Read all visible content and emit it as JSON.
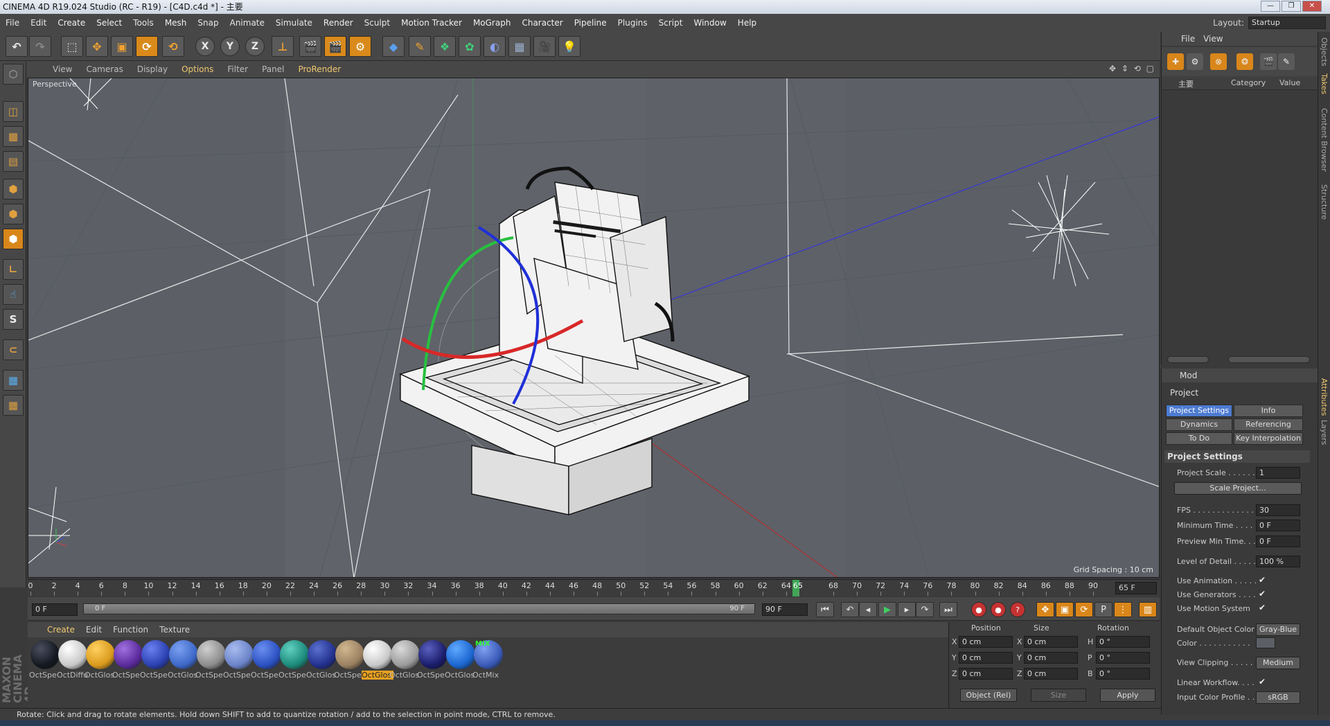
{
  "window": {
    "title": "CINEMA 4D R19.024 Studio (RC - R19) - [C4D.c4d *] - 主要"
  },
  "menu": [
    "File",
    "Edit",
    "Create",
    "Select",
    "Tools",
    "Mesh",
    "Snap",
    "Animate",
    "Simulate",
    "Render",
    "Sculpt",
    "Motion Tracker",
    "MoGraph",
    "Character",
    "Pipeline",
    "Plugins",
    "Script",
    "Window",
    "Help"
  ],
  "layout": {
    "label": "Layout:",
    "value": "Startup"
  },
  "toolbar": {
    "axis_x": "X",
    "axis_y": "Y",
    "axis_z": "Z"
  },
  "viewport_menu": [
    "View",
    "Cameras",
    "Display",
    "Options",
    "Filter",
    "Panel",
    "ProRender"
  ],
  "viewport": {
    "label": "Perspective",
    "grid_spacing": "Grid Spacing : 10 cm",
    "nav": "✥ ⇕ ⟲ ▢"
  },
  "timeline": {
    "ticks": [
      "0",
      "2",
      "4",
      "6",
      "8",
      "10",
      "12",
      "14",
      "16",
      "18",
      "20",
      "22",
      "24",
      "26",
      "28",
      "30",
      "32",
      "34",
      "36",
      "38",
      "40",
      "42",
      "44",
      "46",
      "48",
      "50",
      "52",
      "54",
      "56",
      "58",
      "60",
      "62",
      "64",
      "65",
      "68",
      "70",
      "72",
      "74",
      "76",
      "78",
      "80",
      "82",
      "84",
      "86",
      "88",
      "90"
    ],
    "current_frame": 65,
    "max_frame": 90,
    "end_field": "65 F"
  },
  "transport": {
    "start": "0 F",
    "range_start": "0 F",
    "range_end": "90 F",
    "end": "90 F"
  },
  "material_menu": [
    "Create",
    "Edit",
    "Function",
    "Texture"
  ],
  "materials": [
    {
      "label": "OctSpe",
      "color": "#141820",
      "hi": "#4a5060"
    },
    {
      "label": "OctDiffu",
      "color": "#c8c8c8",
      "hi": "#ffffff"
    },
    {
      "label": "OctGlos",
      "color": "#d99a1c",
      "hi": "#ffd060"
    },
    {
      "label": "OctSpe",
      "color": "#5a2a9c",
      "hi": "#a070e0"
    },
    {
      "label": "OctSpe",
      "color": "#2a40b0",
      "hi": "#6a80f0"
    },
    {
      "label": "OctGlos",
      "color": "#3d68c8",
      "hi": "#7aa0f0"
    },
    {
      "label": "OctSpe",
      "color": "#8c8c8c",
      "hi": "#cfcfcf"
    },
    {
      "label": "OctSpe",
      "color": "#6a82c8",
      "hi": "#a8bcf0"
    },
    {
      "label": "OctSpe",
      "color": "#2a50c0",
      "hi": "#6a8ef0"
    },
    {
      "label": "OctSpe",
      "color": "#1c8a7a",
      "hi": "#60d0c0"
    },
    {
      "label": "OctGlos",
      "color": "#22308c",
      "hi": "#5a70d0"
    },
    {
      "label": "OctSpe",
      "color": "#9a8060",
      "hi": "#d0b890"
    },
    {
      "label": "OctGlos",
      "color": "#c8c8c8",
      "hi": "#ffffff",
      "selected": true
    },
    {
      "label": "OctGlos",
      "color": "#9a9a9a",
      "hi": "#dadada"
    },
    {
      "label": "OctSpe",
      "color": "#1a1c6a",
      "hi": "#5a60c0"
    },
    {
      "label": "OctGlos",
      "color": "#1a66d0",
      "hi": "#60a8ff"
    },
    {
      "label": "OctMix",
      "color": "#3a5ab8",
      "hi": "#80a0f0",
      "tag": "MIX"
    }
  ],
  "coords": {
    "headers": [
      "Position",
      "Size",
      "Rotation"
    ],
    "rows": [
      {
        "a": "X",
        "pos": "0 cm",
        "b": "X",
        "size": "0 cm",
        "c": "H",
        "rot": "0 °"
      },
      {
        "a": "Y",
        "pos": "0 cm",
        "b": "Y",
        "size": "0 cm",
        "c": "P",
        "rot": "0 °"
      },
      {
        "a": "Z",
        "pos": "0 cm",
        "b": "Z",
        "size": "0 cm",
        "c": "B",
        "rot": "0 °"
      }
    ],
    "mode": "Object (Rel)",
    "size_mode": "Size",
    "apply": "Apply"
  },
  "status": "Rotate: Click and drag to rotate elements. Hold down SHIFT to add to quantize rotation / add to the selection in point mode, CTRL to remove.",
  "brand": "MAXON CINEMA 4D",
  "objects_panel": {
    "menu": [
      "File",
      "View"
    ],
    "col_name": "主要",
    "col_category": "Category",
    "col_value": "Value"
  },
  "attributes": {
    "mode": "Mod",
    "title": "Project",
    "tabs": [
      "Project Settings",
      "Info",
      "Dynamics",
      "Referencing",
      "To Do",
      "Key Interpolation"
    ],
    "section": "Project Settings",
    "rows": {
      "project_scale_label": "Project Scale . . . . . .",
      "project_scale": "1",
      "scale_project": "Scale Project...",
      "fps_label": "FPS . . . . . . . . . . . . . . .",
      "fps": "30",
      "min_time_label": "Minimum Time . . . . .",
      "min_time": "0 F",
      "preview_min_label": "Preview Min Time. . .",
      "preview_min": "0 F",
      "lod_label": "Level of Detail . . . . .",
      "lod": "100 %",
      "use_animation": "Use Animation . . . . .",
      "use_generators": "Use Generators . . . .",
      "use_motion": "Use Motion System",
      "default_color_label": "Default Object Color",
      "default_color": "Gray-Blue",
      "color_label": "Color . . . . . . . . . . .",
      "view_clipping_label": "View Clipping . . . . .",
      "view_clipping": "Medium",
      "linear_workflow": "Linear Workflow. . . .",
      "input_profile_label": "Input Color Profile . .",
      "input_profile": "sRGB"
    }
  },
  "right_tabs_top": [
    "Objects",
    "Takes",
    "Content Browser",
    "Structure"
  ],
  "right_tabs_bottom": [
    "Attributes",
    "Layers"
  ]
}
